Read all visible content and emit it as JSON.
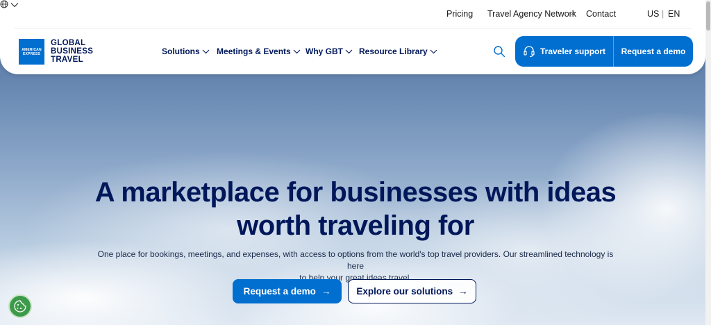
{
  "utility_nav": {
    "pricing": "Pricing",
    "travel_agency_network": "Travel Agency Network",
    "contact": "Contact",
    "region": "US",
    "separator": "|",
    "language": "EN"
  },
  "logo": {
    "badge_line1": "AMERICAN",
    "badge_line2": "EXPRESS",
    "line1": "GLOBAL",
    "line2": "BUSINESS",
    "line3": "TRAVEL"
  },
  "main_nav": {
    "items": [
      {
        "label": "Solutions"
      },
      {
        "label": "Meetings & Events"
      },
      {
        "label": "Why GBT"
      },
      {
        "label": "Resource Library"
      }
    ],
    "traveler_support": "Traveler support",
    "request_demo": "Request a demo"
  },
  "hero": {
    "headline_line1": "A marketplace for businesses with ideas",
    "headline_line2": "worth traveling for",
    "subtext_line1": "One place for bookings, meetings, and expenses, with access to options from the world's top travel providers. Our streamlined technology is here",
    "subtext_line2": "to help your great ideas travel.",
    "cta_primary": "Request a demo",
    "cta_secondary": "Explore our solutions",
    "arrow": "→"
  },
  "colors": {
    "brand_blue": "#006fcf",
    "navy": "#00175a",
    "cookie_green": "#3e9a4b"
  }
}
